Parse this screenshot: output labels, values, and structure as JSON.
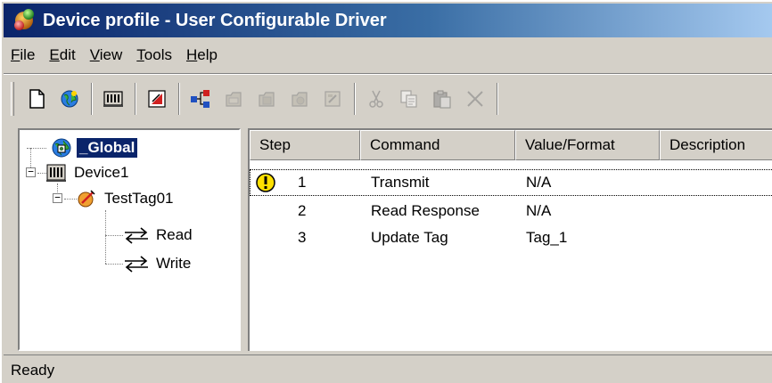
{
  "window": {
    "title": "Device profile - User Configurable Driver",
    "title_icon": "ucd-app-icon"
  },
  "menu": [
    {
      "label": "File",
      "hotkey": "F",
      "rest": "ile"
    },
    {
      "label": "Edit",
      "hotkey": "E",
      "rest": "dit"
    },
    {
      "label": "View",
      "hotkey": "V",
      "rest": "iew"
    },
    {
      "label": "Tools",
      "hotkey": "T",
      "rest": "ools"
    },
    {
      "label": "Help",
      "hotkey": "H",
      "rest": "elp"
    }
  ],
  "toolbar": {
    "buttons": [
      {
        "icon": "new-document-icon",
        "enabled": true
      },
      {
        "icon": "globe-icon",
        "enabled": true
      },
      {
        "icon": "device-icon",
        "enabled": true
      },
      {
        "icon": "tag-icon",
        "enabled": true
      },
      {
        "icon": "transaction-icon",
        "enabled": true
      },
      {
        "icon": "insert-command-icon",
        "enabled": false
      },
      {
        "icon": "insert-command-2-icon",
        "enabled": false
      },
      {
        "icon": "insert-command-3-icon",
        "enabled": false
      },
      {
        "icon": "properties-icon",
        "enabled": false
      },
      {
        "icon": "cut-icon",
        "enabled": false
      },
      {
        "icon": "copy-icon",
        "enabled": false
      },
      {
        "icon": "paste-icon",
        "enabled": false
      },
      {
        "icon": "delete-icon",
        "enabled": false
      }
    ]
  },
  "tree": {
    "global": "_Global",
    "device": "Device1",
    "tag": "TestTag01",
    "read": "Read",
    "write": "Write"
  },
  "list": {
    "columns": [
      "Step",
      "Command",
      "Value/Format",
      "Description"
    ],
    "rows": [
      {
        "step": "1",
        "command": "Transmit",
        "value": "N/A",
        "description": "",
        "warning": true
      },
      {
        "step": "2",
        "command": "Read Response",
        "value": "N/A",
        "description": "",
        "warning": false
      },
      {
        "step": "3",
        "command": "Update Tag",
        "value": "Tag_1",
        "description": "",
        "warning": false
      }
    ]
  },
  "status": {
    "text": "Ready"
  },
  "colors": {
    "title_bar_start": "#0a246a",
    "title_bar_end": "#a6caf0",
    "selection": "#0a246a",
    "face": "#d4d0c8"
  }
}
